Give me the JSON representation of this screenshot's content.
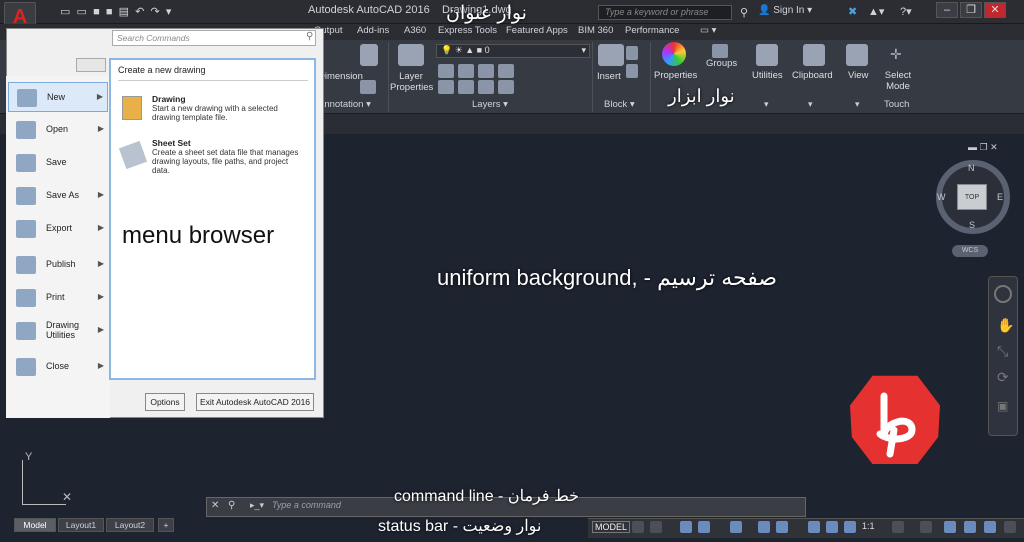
{
  "title_bar": {
    "app_title": "Autodesk AutoCAD 2016",
    "drawing": "Drawing1.dwg",
    "search_placeholder": "Type a keyword or phrase",
    "sign_in": "Sign In",
    "qat_icons": [
      "new-icon",
      "open-icon",
      "save-icon",
      "saveas-icon",
      "print-icon",
      "undo-icon",
      "redo-icon"
    ]
  },
  "ribbon_tabs": [
    "Output",
    "Add-ins",
    "A360",
    "Express Tools",
    "Featured Apps",
    "BIM 360",
    "Performance"
  ],
  "ribbon": {
    "dimension": "Dimension",
    "annotation": "Annotation",
    "layer_properties": "Layer Properties",
    "layers": "Layers",
    "layer_value": "0",
    "insert": "Insert",
    "block": "Block",
    "properties": "Properties",
    "groups": "Groups",
    "utilities": "Utilities",
    "clipboard": "Clipboard",
    "view": "View",
    "select_mode": "Select Mode",
    "touch": "Touch"
  },
  "app_menu": {
    "search_placeholder": "Search Commands",
    "items": [
      {
        "label": "New"
      },
      {
        "label": "Open"
      },
      {
        "label": "Save"
      },
      {
        "label": "Save As"
      },
      {
        "label": "Export"
      },
      {
        "label": "Publish"
      },
      {
        "label": "Print"
      },
      {
        "label": "Drawing Utilities"
      },
      {
        "label": "Close"
      }
    ],
    "right_header": "Create a new drawing",
    "drawing_title": "Drawing",
    "drawing_desc": "Start a new drawing with a selected drawing template file.",
    "sheet_title": "Sheet Set",
    "sheet_desc": "Create a sheet set data file that manages drawing layouts, file paths, and project data.",
    "options": "Options",
    "exit": "Exit Autodesk AutoCAD 2016"
  },
  "viewcube": {
    "top": "TOP",
    "n": "N",
    "s": "S",
    "e": "E",
    "w": "W",
    "wcs": "WCS"
  },
  "ucs": {
    "y": "Y"
  },
  "command_line": {
    "placeholder": "Type a command"
  },
  "layout_tabs": [
    "Model",
    "Layout1",
    "Layout2",
    "+"
  ],
  "status_bar": {
    "model": "MODEL",
    "scale": "1:1"
  },
  "annotations": {
    "title_bar": "نوار عنوان",
    "toolbar": "نوار ابزار",
    "menu_browser": "menu browser",
    "drawing_area": "uniform background, - صفحه ترسیم",
    "command_line": "command line - خط فرمان",
    "status_bar": "status bar - نوار وضعیت"
  },
  "colors": {
    "canvas": "#1e2330",
    "ribbon": "#363a42",
    "accent": "#e5312f",
    "menu_highlight": "#dbe9f8"
  }
}
